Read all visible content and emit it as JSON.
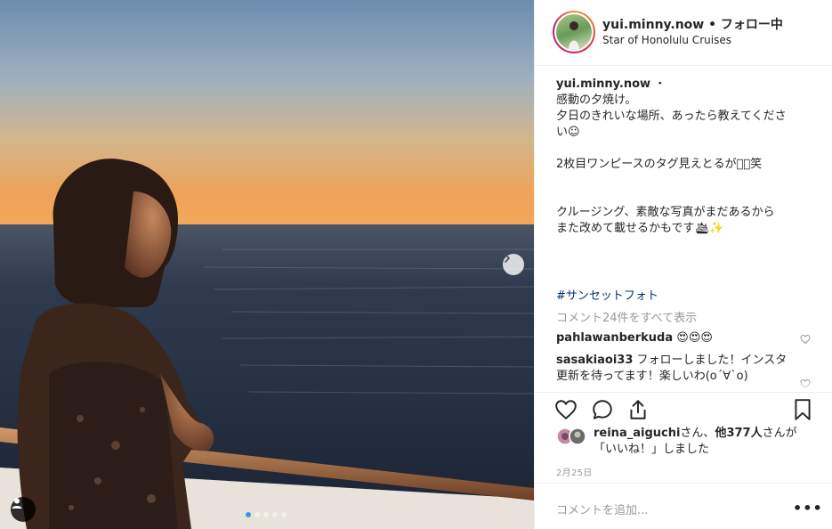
{
  "post": {
    "username": "yui.minny.now",
    "separator": " • ",
    "follow_status": "フォロー中",
    "location": "Star of Honolulu Cruises"
  },
  "caption": {
    "username": "yui.minny.now",
    "dot": " ・",
    "text": "感動の夕焼け。\n夕日のきれいな場所、あったら教えてくださ\nい☺︎\n\n2枚目ワンピースのタグ見えとるがな🏻笑\n\n\nクルージング、素敵な写真がまだあるから\nまた改めて載せるかもです🛳✨",
    "hashtag": "#サンセットフォト"
  },
  "view_all_comments": "コメント24件をすべて表示",
  "comments": [
    {
      "username": "pahlawanberkuda",
      "text": "😍😍😍"
    },
    {
      "username": "sasakiaoi33",
      "text": "フォローしました！インスタ更新を待ってます！楽しいわ(o´∀`o)"
    }
  ],
  "likes": {
    "first_user": "reina_aiguchi",
    "san": "さん、",
    "others": "他377人",
    "suffix": "さんが「いいね！」しました"
  },
  "date": "2月25日",
  "add_comment_placeholder": "コメントを追加...",
  "more_label": "•••",
  "carousel": {
    "current": 1,
    "total": 5
  },
  "colors": {
    "link": "#003569",
    "muted": "#999999",
    "dot_active": "#3897f0"
  }
}
